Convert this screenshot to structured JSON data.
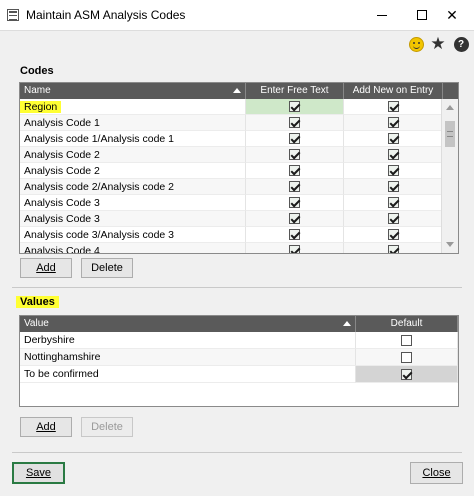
{
  "window": {
    "title": "Maintain ASM Analysis Codes",
    "minimize_label": "—",
    "maximize_label": "☐",
    "close_label": "✕"
  },
  "toolbar": {
    "icons": [
      "smiley-icon",
      "star-icon",
      "help-icon"
    ],
    "help_glyph": "?"
  },
  "codes": {
    "section_label": "Codes",
    "columns": [
      "Name",
      "Enter Free Text",
      "Add New on Entry"
    ],
    "rows": [
      {
        "name": "Region",
        "free_text": true,
        "add_new": true,
        "highlight": true
      },
      {
        "name": "Analysis Code 1",
        "free_text": true,
        "add_new": true
      },
      {
        "name": "Analysis code 1/Analysis code 1",
        "free_text": true,
        "add_new": true
      },
      {
        "name": "Analysis Code 2",
        "free_text": true,
        "add_new": true
      },
      {
        "name": "Analysis Code 2",
        "free_text": true,
        "add_new": true
      },
      {
        "name": "Analysis code 2/Analysis code 2",
        "free_text": true,
        "add_new": true
      },
      {
        "name": "Analysis Code 3",
        "free_text": true,
        "add_new": true
      },
      {
        "name": "Analysis Code 3",
        "free_text": true,
        "add_new": true
      },
      {
        "name": "Analysis code 3/Analysis code 3",
        "free_text": true,
        "add_new": true
      },
      {
        "name": "Analysis Code 4",
        "free_text": true,
        "add_new": true
      }
    ],
    "add_button": "Add",
    "delete_button": "Delete"
  },
  "values": {
    "section_label": "Values",
    "columns": [
      "Value",
      "Default"
    ],
    "rows": [
      {
        "value": "Derbyshire",
        "default": false
      },
      {
        "value": "Nottinghamshire",
        "default": false
      },
      {
        "value": "To be confirmed",
        "default": true
      }
    ],
    "add_button": "Add",
    "delete_button": "Delete"
  },
  "footer": {
    "save_button": "Save",
    "close_button": "Close"
  },
  "colors": {
    "highlight": "#ffff33",
    "header_bg": "#5a5a5a",
    "selected_cell": "#cfe8c9",
    "save_border": "#2a7a43"
  }
}
